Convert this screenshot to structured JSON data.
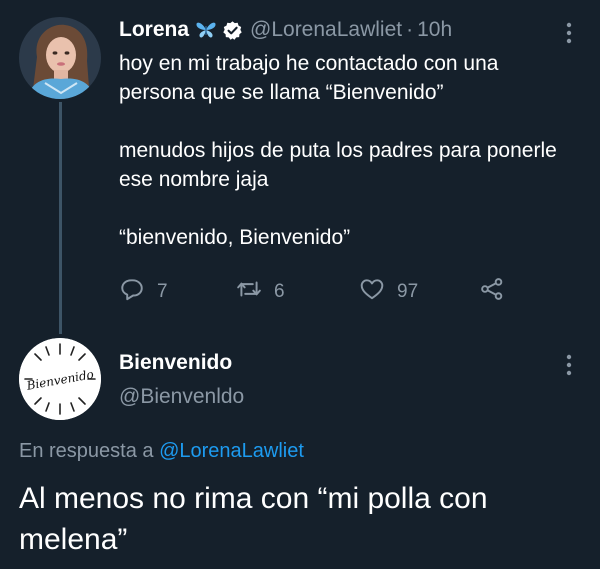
{
  "tweet": {
    "author": {
      "name": "Lorena",
      "handle": "@LorenaLawliet",
      "separator": "·",
      "time": "10h",
      "decorations": [
        "butterfly-icon",
        "verified-badge-icon"
      ]
    },
    "paragraphs": [
      "hoy en mi trabajo he contactado con una persona que se llama “Bienvenido”",
      "menudos hijos de puta los padres para ponerle ese nombre jaja",
      "“bienvenido, Bienvenido”"
    ],
    "actions": {
      "replies": "7",
      "retweets": "6",
      "likes": "97"
    }
  },
  "reply": {
    "author": {
      "name": "Bienvenido",
      "handle": "@Bienvenldo",
      "avatar_text": "Bienvenido"
    },
    "in_reply_to_prefix": "En respuesta a",
    "in_reply_to_handle": "@LorenaLawliet",
    "text": "Al menos no rima con “mi polla con melena”"
  },
  "colors": {
    "background": "#15202b",
    "text_primary": "#ffffff",
    "text_secondary": "#8b98a5",
    "accent": "#1d9bf0",
    "thread_line": "#3d5466"
  }
}
